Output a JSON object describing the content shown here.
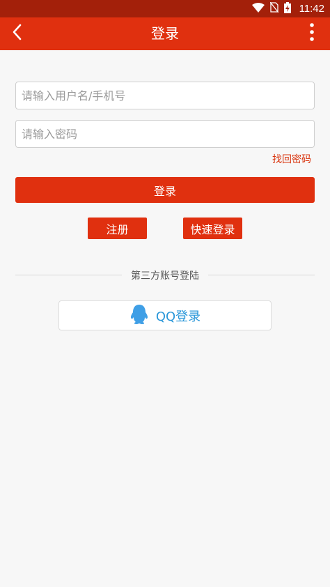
{
  "status_bar": {
    "time": "11:42"
  },
  "app_bar": {
    "title": "登录"
  },
  "form": {
    "username_placeholder": "请输入用户名/手机号",
    "username_value": "",
    "password_placeholder": "请输入密码",
    "password_value": "",
    "forgot_label": "找回密码",
    "login_label": "登录",
    "register_label": "注册",
    "quick_login_label": "快速登录"
  },
  "third_party": {
    "divider_label": "第三方账号登陆",
    "qq_label": "QQ登录"
  },
  "colors": {
    "primary": "#e0300f",
    "status_bar": "#a3200a",
    "qq_blue": "#2a97d9",
    "background": "#f7f7f7"
  },
  "icons": [
    "wifi-icon",
    "no-sim-icon",
    "battery-charging-icon",
    "back-arrow-icon",
    "more-vertical-icon",
    "qq-penguin-icon"
  ]
}
